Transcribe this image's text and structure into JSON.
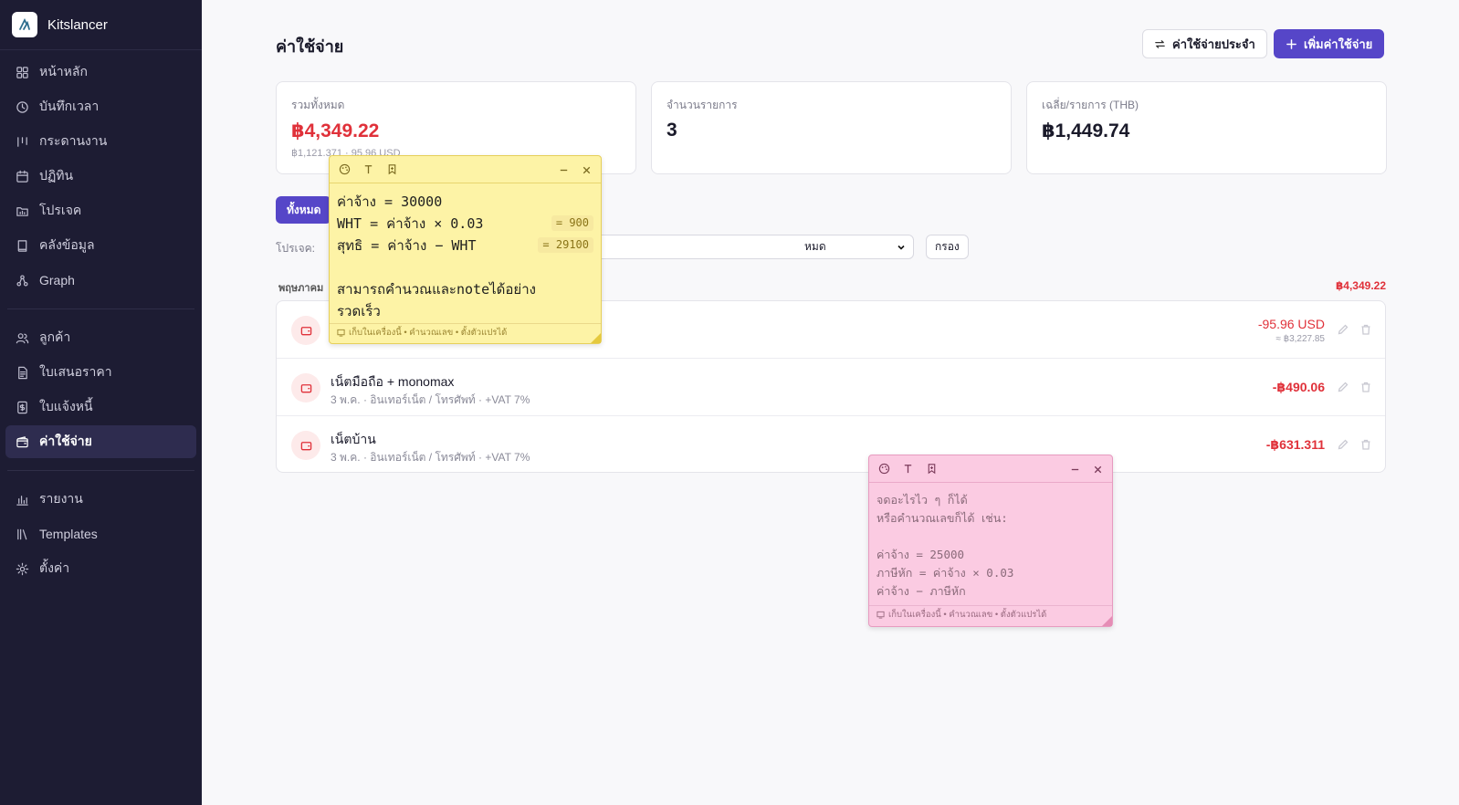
{
  "app": {
    "name": "Kitslancer"
  },
  "sidebar": {
    "group1": [
      {
        "label": "หน้าหลัก",
        "icon": "grid-icon"
      },
      {
        "label": "บันทึกเวลา",
        "icon": "clock-icon"
      },
      {
        "label": "กระดานงาน",
        "icon": "kanban-icon"
      },
      {
        "label": "ปฏิทิน",
        "icon": "calendar-icon"
      },
      {
        "label": "โปรเจค",
        "icon": "folder-chart-icon"
      },
      {
        "label": "คลังข้อมูล",
        "icon": "book-icon"
      },
      {
        "label": "Graph",
        "icon": "graph-icon"
      }
    ],
    "group2": [
      {
        "label": "ลูกค้า",
        "icon": "users-icon"
      },
      {
        "label": "ใบเสนอราคา",
        "icon": "document-icon"
      },
      {
        "label": "ใบแจ้งหนี้",
        "icon": "invoice-icon"
      },
      {
        "label": "ค่าใช้จ่าย",
        "icon": "wallet-icon",
        "active": true
      }
    ],
    "group3": [
      {
        "label": "รายงาน",
        "icon": "bar-chart-icon"
      },
      {
        "label": "Templates",
        "icon": "library-icon"
      },
      {
        "label": "ตั้งค่า",
        "icon": "gear-icon"
      }
    ]
  },
  "header": {
    "title": "ค่าใช้จ่าย",
    "recurring_label": "ค่าใช้จ่ายประจำ",
    "add_label": "เพิ่มค่าใช้จ่าย"
  },
  "stats": [
    {
      "label": "รวมทั้งหมด",
      "value": "฿4,349.22",
      "sub": "฿1,121.371 · 95.96 USD",
      "color": "#e0313a"
    },
    {
      "label": "จำนวนรายการ",
      "value": "3"
    },
    {
      "label": "เฉลี่ย/รายการ (THB)",
      "value": "฿1,449.74"
    }
  ],
  "filters": {
    "tab_all": "ทั้งหมด",
    "project_label": "โปรเจค:",
    "select_value": "หมด",
    "apply_label": "กรอง"
  },
  "group": {
    "label": "พฤษภาคม",
    "total": "฿4,349.22"
  },
  "expenses": [
    {
      "title": "",
      "meta": "",
      "amount": "-95.96 USD",
      "converted": "≈ ฿3,227.85"
    },
    {
      "title": "เน็ตมือถือ + monomax",
      "meta": "3 พ.ค.  · อินเทอร์เน็ต / โทรศัพท์  · +VAT 7%",
      "amount": "-฿490.06"
    },
    {
      "title": "เน็ตบ้าน",
      "meta": "3 พ.ค.  · อินเทอร์เน็ต / โทรศัพท์  · +VAT 7%",
      "amount": "-฿631.311"
    }
  ],
  "sticky_yellow": {
    "lines": [
      {
        "text": "ค่าจ้าง = 30000",
        "result": ""
      },
      {
        "text": "WHT = ค่าจ้าง × 0.03",
        "result": "= 900"
      },
      {
        "text": "สุทธิ = ค่าจ้าง − WHT",
        "result": "= 29100"
      },
      {
        "text": "",
        "result": ""
      },
      {
        "text": "สามารถคำนวณและnoteได้อย่าง",
        "result": ""
      },
      {
        "text": "รวดเร็ว",
        "result": ""
      }
    ],
    "footer": "เก็บในเครื่องนี้ • คำนวณเลข • ตั้งตัวแปรได้"
  },
  "sticky_pink": {
    "lines": [
      "จดอะไรไว ๆ ก็ได้",
      "หรือคำนวณเลขก็ได้ เช่น:",
      "",
      "ค่าจ้าง = 25000",
      "ภาษีหัก = ค่าจ้าง × 0.03",
      "ค่าจ้าง − ภาษีหัก"
    ],
    "footer": "เก็บในเครื่องนี้ • คำนวณเลข • ตั้งตัวแปรได้"
  },
  "colors": {
    "sidebar": "#1d1c33",
    "primary": "#5646c8",
    "expense": "#e0313a",
    "sticky_yellow": "#fdf3a6",
    "sticky_pink": "#fbcbe2"
  }
}
